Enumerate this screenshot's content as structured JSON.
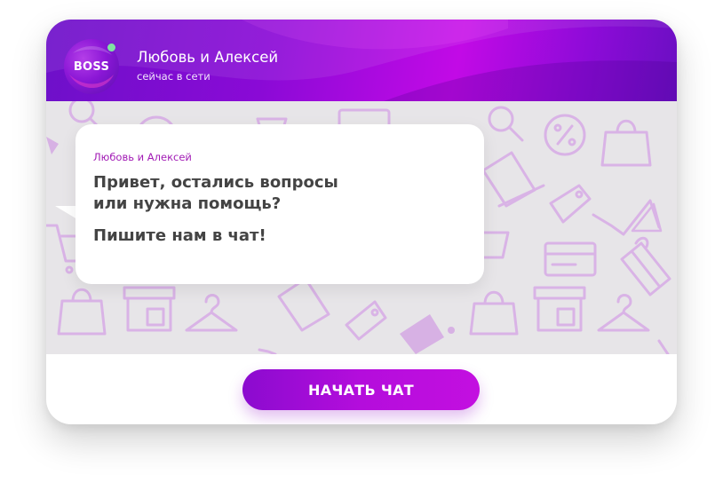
{
  "header": {
    "avatar_text": "BOSS",
    "name": "Любовь и Алексей",
    "status": "сейчас в сети",
    "online_color": "#7fe3a2"
  },
  "message": {
    "sender": "Любовь и Алексей",
    "line1": "Привет, остались вопросы",
    "line2": "или нужна помощь?",
    "line3": "Пишите нам в чат!"
  },
  "actions": {
    "start_chat_label": "НАЧАТЬ ЧАТ"
  },
  "colors": {
    "accent": "#a20ed8",
    "pattern_icon": "#d9b3e6",
    "chat_bg": "#e7e5e8"
  },
  "icons": [
    "shopping-bag-icon",
    "storefront-icon",
    "hanger-icon",
    "price-tag-icon",
    "shopping-cart-icon",
    "laptop-icon",
    "credit-card-icon",
    "gift-box-icon",
    "discount-icon",
    "magnifier-icon"
  ]
}
